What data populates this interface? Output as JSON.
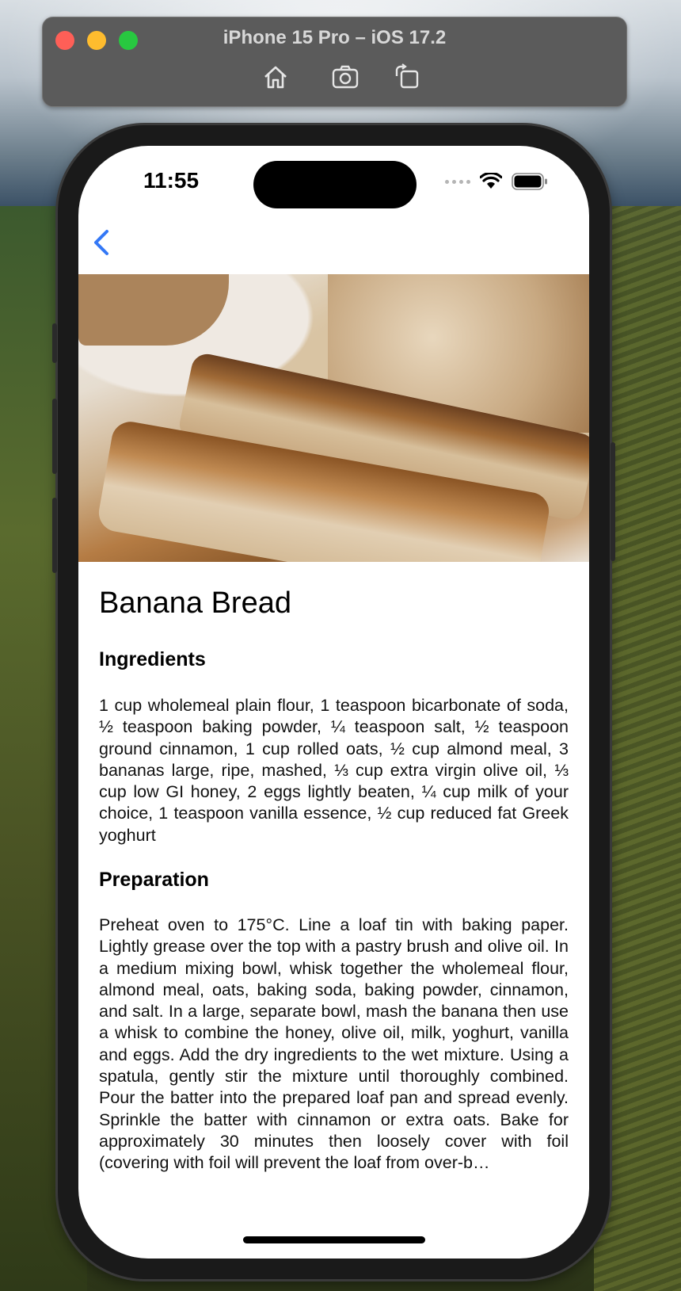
{
  "simulator": {
    "title": "iPhone 15 Pro – iOS 17.2",
    "toolbar": [
      "home-icon",
      "screenshot-icon",
      "rotate-icon"
    ],
    "traffic_lights": {
      "close": "#fe5f57",
      "minimize": "#febc2e",
      "zoom": "#28c840"
    }
  },
  "status_bar": {
    "time": "11:55",
    "icons": [
      "cellular-dots-icon",
      "wifi-icon",
      "battery-icon"
    ]
  },
  "nav": {
    "back_icon": "chevron-left-icon",
    "accent": "#3478f6"
  },
  "recipe": {
    "image_alt": "banana-bread-photo",
    "title": "Banana Bread",
    "ingredients_heading": "Ingredients",
    "ingredients": "1 cup wholemeal plain flour, 1 teaspoon bicarbonate of soda, ½ teaspoon baking powder, ¼ teaspoon salt, ½ teaspoon ground cinnamon, 1 cup rolled oats, ½ cup almond meal, 3 bananas large, ripe, mashed, ⅓ cup extra virgin olive oil, ⅓ cup low GI honey, 2 eggs lightly beaten, ¼ cup milk of your choice, 1 teaspoon vanilla essence, ½ cup reduced fat Greek yoghurt",
    "preparation_heading": "Preparation",
    "preparation": "Preheat oven to 175°C. Line a loaf tin with baking paper. Lightly grease over the top with a pastry brush and olive oil. In a medium mixing bowl, whisk together the wholemeal flour, almond meal, oats, baking soda, baking powder, cinnamon, and salt. In a large, separate bowl, mash the banana then use a whisk to combine the honey, olive oil, milk, yoghurt, vanilla and eggs. Add the dry ingredients to the wet mixture. Using a spatula, gently stir the mixture until thoroughly combined. Pour the batter into the prepared loaf pan and spread evenly. Sprinkle the batter with cinnamon or extra oats. Bake for approximately 30 minutes then loosely cover with foil (covering with foil will prevent the loaf from over-b…"
  }
}
